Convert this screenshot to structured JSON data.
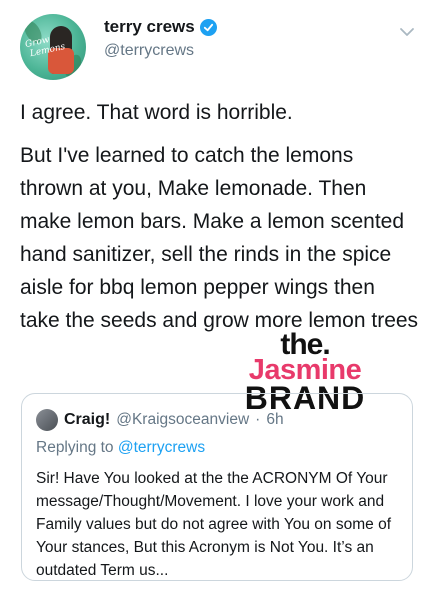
{
  "tweet": {
    "display_name": "terry crews",
    "handle": "@terrycrews",
    "paragraphs": [
      "I agree. That word is horrible.",
      "But I've learned to catch the lemons thrown at you, Make lemonade. Then make lemon bars. Make a lemon scented hand sanitizer, sell the rinds in the spice aisle for bbq lemon pepper wings then take the seeds and grow more lemon trees"
    ]
  },
  "quoted": {
    "display_name": "Craig!",
    "handle": "@Kraigsoceanview",
    "sep": "·",
    "time": "6h",
    "replying_label": "Replying to",
    "replying_handle": "@terrycrews",
    "text": "Sir! Have You looked at the the ACRONYM Of Your message/Thought/Movement.  I love your work and Family values but do not agree with You on some of Your stances,  But this Acronym is Not You. It’s an outdated Term us..."
  },
  "watermark": {
    "line1": "the.",
    "line2": "Jasmine",
    "line3": "BRAND"
  },
  "colors": {
    "accent": "#1da1f2",
    "secondary_text": "#657786",
    "watermark_pink": "#e83a6b"
  },
  "icons": [
    "verified-badge-icon",
    "chevron-down-icon"
  ]
}
